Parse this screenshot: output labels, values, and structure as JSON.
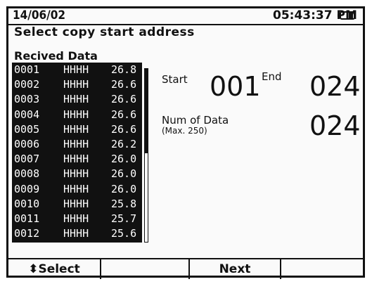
{
  "status": {
    "date": "14/06/02",
    "time": "05:43:37 PM"
  },
  "prompt": "Select copy start address",
  "received": {
    "title": "Recived Data",
    "rows": [
      {
        "no": "0001",
        "hex": "HHHH",
        "val": "26.8"
      },
      {
        "no": "0002",
        "hex": "HHHH",
        "val": "26.6"
      },
      {
        "no": "0003",
        "hex": "HHHH",
        "val": "26.6"
      },
      {
        "no": "0004",
        "hex": "HHHH",
        "val": "26.6"
      },
      {
        "no": "0005",
        "hex": "HHHH",
        "val": "26.6"
      },
      {
        "no": "0006",
        "hex": "HHHH",
        "val": "26.2"
      },
      {
        "no": "0007",
        "hex": "HHHH",
        "val": "26.0"
      },
      {
        "no": "0008",
        "hex": "HHHH",
        "val": "26.0"
      },
      {
        "no": "0009",
        "hex": "HHHH",
        "val": "26.0"
      },
      {
        "no": "0010",
        "hex": "HHHH",
        "val": "25.8"
      },
      {
        "no": "0011",
        "hex": "HHHH",
        "val": "25.7"
      },
      {
        "no": "0012",
        "hex": "HHHH",
        "val": "25.6"
      }
    ]
  },
  "range": {
    "start_label": "Start",
    "start_value": "001",
    "end_label": "End",
    "end_value": "024",
    "num_label": "Num of Data",
    "num_sub": "(Max. 250)",
    "num_value": "024"
  },
  "footer": {
    "keys": [
      "⬍Select",
      "",
      "Next",
      ""
    ]
  }
}
